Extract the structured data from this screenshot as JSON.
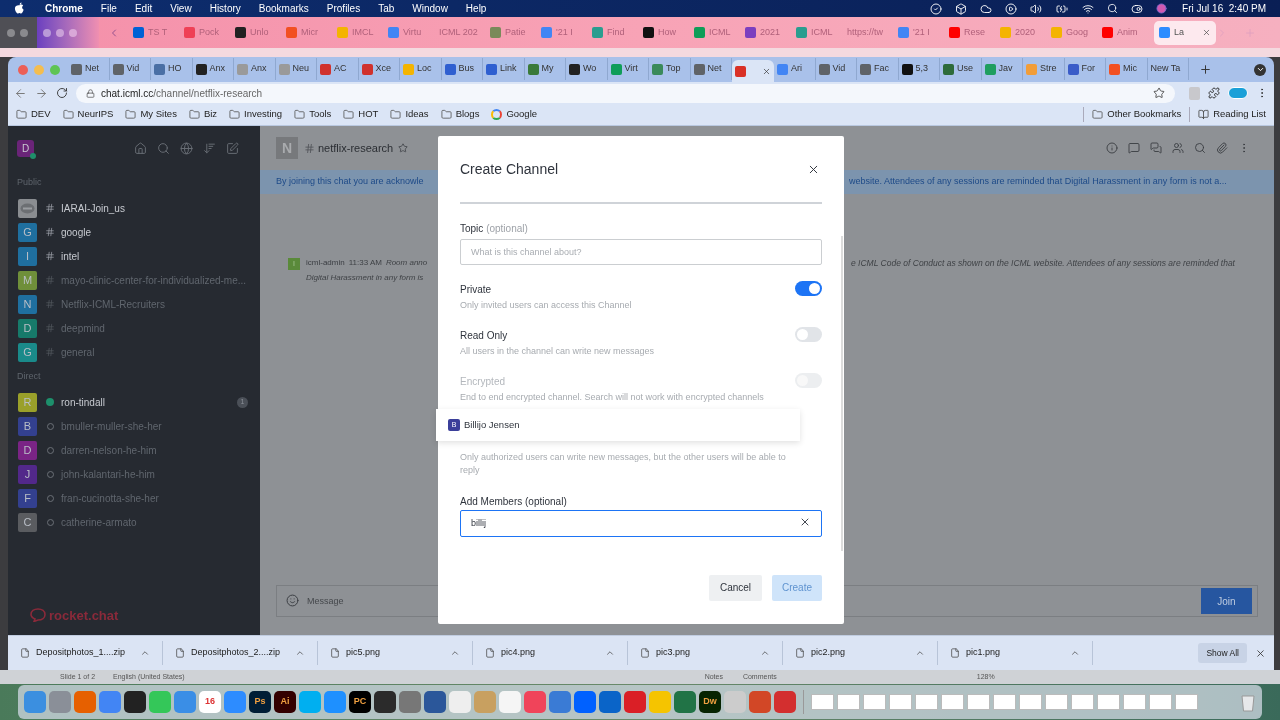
{
  "menu_bar": {
    "app": "Chrome",
    "menus": [
      "File",
      "Edit",
      "View",
      "History",
      "Bookmarks",
      "Profiles",
      "Tab",
      "Window",
      "Help"
    ],
    "clock": "Fri Jul 16  2:40 PM"
  },
  "back_window": {
    "tabs": [
      {
        "label": "TS T",
        "color": "#0061d5",
        "selected": false
      },
      {
        "label": "Pock",
        "color": "#ef4056",
        "selected": false
      },
      {
        "label": "Unlo",
        "color": "#222222",
        "selected": false
      },
      {
        "label": "Micr",
        "color": "#f25022",
        "selected": false
      },
      {
        "label": "IMCL",
        "color": "#f4b400",
        "selected": false
      },
      {
        "label": "Virtu",
        "color": "#4285f4",
        "selected": false
      },
      {
        "label": "ICML 202",
        "selected": false
      },
      {
        "label": "Patie",
        "color": "#7a8a5a",
        "selected": false
      },
      {
        "label": "'21 I",
        "color": "#4285f4",
        "selected": false
      },
      {
        "label": "Find",
        "color": "#2a9d8f",
        "selected": false
      },
      {
        "label": "How",
        "color": "#111111",
        "selected": false
      },
      {
        "label": "ICML",
        "color": "#0f9d58",
        "selected": false
      },
      {
        "label": "2021",
        "color": "#7b3fbf",
        "selected": false
      },
      {
        "label": "ICML",
        "color": "#2a9d8f",
        "selected": false
      },
      {
        "label": "https://tw",
        "selected": false
      },
      {
        "label": "'21 I",
        "color": "#4285f4",
        "selected": false
      },
      {
        "label": "Rese",
        "color": "#ff0000",
        "selected": false
      },
      {
        "label": "2020",
        "color": "#f4b400",
        "selected": false
      },
      {
        "label": "Goog",
        "color": "#f4b400",
        "selected": false
      },
      {
        "label": "Anim",
        "color": "#ff0000",
        "selected": false
      },
      {
        "label": "La",
        "color": "#2d8cff",
        "selected": true
      }
    ]
  },
  "browser": {
    "tabs": [
      {
        "label": "Net",
        "color": "#5f6368",
        "selected": false
      },
      {
        "label": "Vid",
        "color": "#5f6368",
        "selected": false
      },
      {
        "label": "HO",
        "color": "#4a6fa5",
        "selected": false
      },
      {
        "label": "Anx",
        "color": "#222222",
        "selected": false
      },
      {
        "label": "Anx",
        "color": "#9a9a9a",
        "selected": false
      },
      {
        "label": "Neu",
        "color": "#9a9a9a",
        "selected": false
      },
      {
        "label": "AC",
        "color": "#d0312d",
        "selected": false
      },
      {
        "label": "Xce",
        "color": "#d0312d",
        "selected": false
      },
      {
        "label": "Loc",
        "color": "#f4b400",
        "selected": false
      },
      {
        "label": "Bus",
        "color": "#2f5fd0",
        "selected": false
      },
      {
        "label": "Link",
        "color": "#2f5fd0",
        "selected": false
      },
      {
        "label": "My",
        "color": "#3a7a3a",
        "selected": false
      },
      {
        "label": "Wo",
        "color": "#222222",
        "selected": false
      },
      {
        "label": "Virt",
        "color": "#0f9d58",
        "selected": false
      },
      {
        "label": "Top",
        "color": "#3a8a5a",
        "selected": false
      },
      {
        "label": "Net",
        "color": "#5f6368",
        "selected": false
      },
      {
        "color": "#d93025",
        "selected": true
      },
      {
        "label": "Ari",
        "color": "#4285f4",
        "selected": false
      },
      {
        "label": "Vid",
        "color": "#5f6368",
        "selected": false
      },
      {
        "label": "Fac",
        "color": "#5f6368",
        "selected": false
      },
      {
        "label": "5,3",
        "color": "#111111",
        "selected": false
      },
      {
        "label": "Use",
        "color": "#2e6b3a",
        "selected": false
      },
      {
        "label": "Jav",
        "color": "#1f9e5f",
        "selected": false
      },
      {
        "label": "Stre",
        "color": "#f29d38",
        "selected": false
      },
      {
        "label": "For",
        "color": "#3a5cc8",
        "selected": false
      },
      {
        "label": "Mic",
        "color": "#f25022",
        "selected": false
      },
      {
        "label": "New Ta",
        "selected": false
      }
    ],
    "url_host": "chat.icml.cc",
    "url_path": "/channel/netflix-research",
    "bookmarks": [
      {
        "label": "DEV",
        "kind": "folder"
      },
      {
        "label": "NeurIPS",
        "kind": "folder"
      },
      {
        "label": "My Sites",
        "kind": "folder"
      },
      {
        "label": "Biz",
        "kind": "folder"
      },
      {
        "label": "Investing",
        "kind": "folder"
      },
      {
        "label": "Tools",
        "kind": "folder"
      },
      {
        "label": "HOT",
        "kind": "folder"
      },
      {
        "label": "Ideas",
        "kind": "folder"
      },
      {
        "label": "Blogs",
        "kind": "folder"
      },
      {
        "label": "Google",
        "kind": "site"
      }
    ],
    "other_bookmarks": "Other Bookmarks",
    "reading_list": "Reading List"
  },
  "sidebar": {
    "user_initial": "D",
    "sections": [
      {
        "title": "Public",
        "items": [
          {
            "name": "IARAI-Join_us",
            "unread": true
          },
          {
            "name": "google",
            "initial": "G",
            "color": "#1f6f9f",
            "unread": true
          },
          {
            "name": "intel",
            "initial": "I",
            "color": "#1f6f9f",
            "unread": true
          },
          {
            "name": "mayo-clinic-center-for-individualized-me...",
            "initial": "M",
            "color": "#6f8f3a",
            "unread": false
          },
          {
            "name": "Netflix-ICML-Recruiters",
            "initial": "N",
            "color": "#1f6f9f",
            "unread": false
          },
          {
            "name": "deepmind",
            "initial": "D",
            "color": "#177a6a",
            "unread": false
          },
          {
            "name": "general",
            "initial": "G",
            "color": "#1a8a8a",
            "unread": false
          }
        ]
      },
      {
        "title": "Direct",
        "items": [
          {
            "name": "ron-tindall",
            "initial": "R",
            "color": "#9aa02a",
            "online": true,
            "unread": true,
            "badge": "1"
          },
          {
            "name": "bmuller-muller-she-her",
            "initial": "B",
            "color": "#33408f",
            "online": false,
            "unread": false
          },
          {
            "name": "darren-nelson-he-him",
            "initial": "D",
            "color": "#7a2485",
            "online": false,
            "unread": false
          },
          {
            "name": "john-kalantari-he-him",
            "initial": "J",
            "color": "#52288a",
            "online": false,
            "unread": false
          },
          {
            "name": "fran-cucinotta-she-her",
            "initial": "F",
            "color": "#33408f",
            "online": false,
            "unread": false
          },
          {
            "name": "catherine-armato",
            "initial": "C",
            "color": "#5a5c60",
            "online": false,
            "unread": false
          }
        ]
      }
    ],
    "brand": "rocket.chat"
  },
  "room": {
    "initial": "N",
    "name": "netflix-research",
    "banner_left": "By joining this chat you are acknowle",
    "banner_right": "website. Attendees of any sessions are reminded that Digital Harassment in any form is not a...",
    "message": {
      "initial": "I",
      "author": "icml-admin",
      "time": "11:33 AM",
      "left_first": "Room anno",
      "left_second": "Digital Harassment in any form is",
      "right_first": "e ICML Code of Conduct as shown on the ICML website. Attendees of any sessions are reminded that"
    },
    "composer_placeholder": "Message",
    "join": "Join"
  },
  "modal": {
    "title": "Create Channel",
    "topic": {
      "label": "Topic",
      "hint": "(optional)",
      "placeholder": "What is this channel about?"
    },
    "toggles": [
      {
        "label": "Private",
        "description": "Only invited users can access this Channel",
        "on": true,
        "disabled": false
      },
      {
        "label": "Read Only",
        "description": "All users in the channel can write new messages",
        "on": false,
        "disabled": false
      },
      {
        "label": "Encrypted",
        "description": "End to end encrypted channel. Search will not work with encrypted channels",
        "on": false,
        "disabled": true
      }
    ],
    "suggestion": {
      "initial": "B",
      "name": "Billijo Jensen"
    },
    "broadcast_description": "Only authorized users can write new messages, but the other users will be able to reply",
    "members": {
      "label": "Add Members (optional)",
      "value": "billij"
    },
    "cancel": "Cancel",
    "create": {
      "label": "Create",
      "disabled": true
    }
  },
  "downloads": {
    "items": [
      "Depositphotos_1....zip",
      "Depositphotos_2....zip",
      "pic5.png",
      "pic4.png",
      "pic3.png",
      "pic2.png",
      "pic1.png"
    ],
    "show_all": "Show All"
  },
  "background_status": {
    "left": [
      "Slide 1 of 2",
      "English (United States)"
    ],
    "right": [
      "Notes",
      "Comments"
    ],
    "zoom": "128%"
  },
  "dock": [
    {
      "color": "#3b8fe0"
    },
    {
      "color": "#8a8f98"
    },
    {
      "color": "#e66000"
    },
    {
      "color": "#4285f4"
    },
    {
      "color": "#222222"
    },
    {
      "color": "#34c759"
    },
    {
      "color": "#3a8ee6"
    },
    {
      "color": "#ffffff",
      "label": "16"
    },
    {
      "color": "#2d8cff"
    },
    {
      "color": "#001e36",
      "label": "Ps"
    },
    {
      "color": "#330000",
      "label": "Ai"
    },
    {
      "color": "#00aff0"
    },
    {
      "color": "#1e90ff"
    },
    {
      "color": "#000000",
      "label": "PC"
    },
    {
      "color": "#2b2b2b"
    },
    {
      "color": "#777777"
    },
    {
      "color": "#2b579a"
    },
    {
      "color": "#eeeeee"
    },
    {
      "color": "#c8a060"
    },
    {
      "color": "#f5f5f5"
    },
    {
      "color": "#f0445a"
    },
    {
      "color": "#3a7bd5"
    },
    {
      "color": "#0061ff"
    },
    {
      "color": "#0a64c8"
    },
    {
      "color": "#da1f26"
    },
    {
      "color": "#f5c400"
    },
    {
      "color": "#217346"
    },
    {
      "color": "#072401",
      "label": "Dw"
    },
    {
      "color": "#cccccc"
    },
    {
      "color": "#d24726"
    },
    {
      "color": "#d32f2f"
    }
  ]
}
